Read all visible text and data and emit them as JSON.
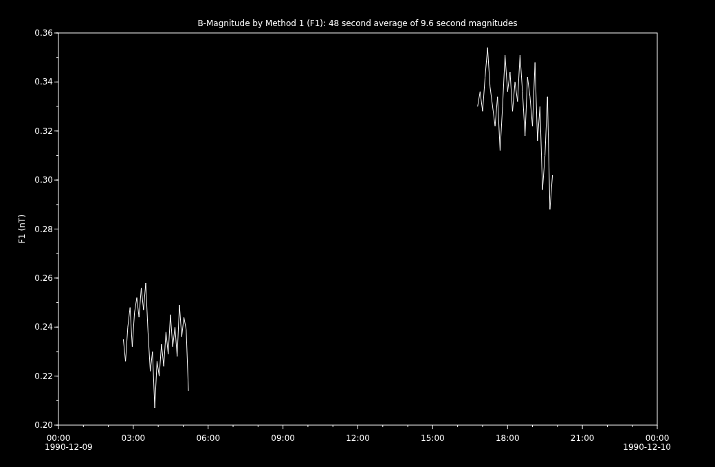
{
  "chart_data": {
    "type": "line",
    "title": "B-Magnitude by Method 1 (F1): 48 second average of 9.6 second magnitudes",
    "ylabel": "F1 (nT)",
    "x": [
      2.6,
      2.69,
      2.78,
      2.87,
      2.96,
      3.05,
      3.14,
      3.23,
      3.32,
      3.41,
      3.5,
      3.59,
      3.68,
      3.77,
      3.86,
      3.95,
      4.04,
      4.13,
      4.22,
      4.31,
      4.4,
      4.49,
      4.58,
      4.67,
      4.76,
      4.85,
      4.94,
      5.03,
      5.12,
      5.21,
      12,
      16.8,
      16.9,
      17,
      17.1,
      17.2,
      17.3,
      17.4,
      17.5,
      17.6,
      17.7,
      17.8,
      17.9,
      18,
      18.1,
      18.2,
      18.3,
      18.4,
      18.5,
      18.6,
      18.7,
      18.8,
      18.9,
      19,
      19.1,
      19.2,
      19.3,
      19.4,
      19.5,
      19.6,
      19.7,
      19.8
    ],
    "series": [
      {
        "color": "#ffffff",
        "values": [
          0.235,
          0.226,
          0.24,
          0.248,
          0.232,
          0.246,
          0.252,
          0.244,
          0.256,
          0.247,
          0.258,
          0.238,
          0.222,
          0.23,
          0.207,
          0.226,
          0.22,
          0.233,
          0.224,
          0.238,
          0.229,
          0.245,
          0.232,
          0.24,
          0.228,
          0.249,
          0.236,
          0.244,
          0.239,
          0.214,
          null,
          0.33,
          0.336,
          0.328,
          0.342,
          0.354,
          0.338,
          0.33,
          0.322,
          0.334,
          0.312,
          0.33,
          0.351,
          0.336,
          0.344,
          0.328,
          0.34,
          0.332,
          0.351,
          0.336,
          0.318,
          0.342,
          0.334,
          0.322,
          0.348,
          0.316,
          0.33,
          0.296,
          0.31,
          0.334,
          0.288,
          0.302
        ]
      }
    ],
    "xlim": [
      0,
      24
    ],
    "ylim": [
      0.2,
      0.36
    ],
    "xticks": [
      {
        "value": 0,
        "label": "00:00"
      },
      {
        "value": 3,
        "label": "03:00"
      },
      {
        "value": 6,
        "label": "06:00"
      },
      {
        "value": 9,
        "label": "09:00"
      },
      {
        "value": 12,
        "label": "12:00"
      },
      {
        "value": 15,
        "label": "15:00"
      },
      {
        "value": 18,
        "label": "18:00"
      },
      {
        "value": 21,
        "label": "21:00"
      },
      {
        "value": 24,
        "label": "00:00"
      }
    ],
    "yticks": [
      {
        "value": 0.2,
        "label": "0.20"
      },
      {
        "value": 0.22,
        "label": "0.22"
      },
      {
        "value": 0.24,
        "label": "0.24"
      },
      {
        "value": 0.26,
        "label": "0.26"
      },
      {
        "value": 0.28,
        "label": "0.28"
      },
      {
        "value": 0.3,
        "label": "0.30"
      },
      {
        "value": 0.32,
        "label": "0.32"
      },
      {
        "value": 0.34,
        "label": "0.34"
      },
      {
        "value": 0.36,
        "label": "0.36"
      }
    ],
    "annotations": [
      "1990-12-09",
      "1990-12-10"
    ]
  }
}
